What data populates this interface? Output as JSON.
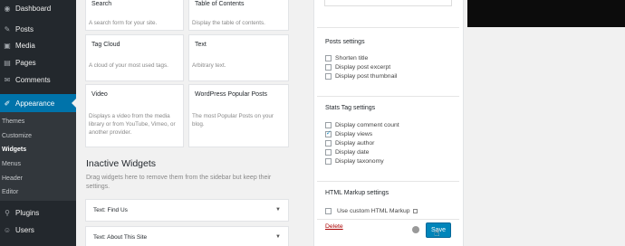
{
  "sidebar": {
    "items": [
      {
        "label": "Dashboard",
        "icon": "dashboard-icon",
        "glyph": "◉"
      },
      {
        "label": "Posts",
        "icon": "pin-icon",
        "glyph": "✎"
      },
      {
        "label": "Media",
        "icon": "media-icon",
        "glyph": "▣"
      },
      {
        "label": "Pages",
        "icon": "pages-icon",
        "glyph": "▤"
      },
      {
        "label": "Comments",
        "icon": "comments-icon",
        "glyph": "✉"
      },
      {
        "label": "Appearance",
        "icon": "brush-icon",
        "glyph": "✐"
      },
      {
        "label": "Plugins",
        "icon": "plugin-icon",
        "glyph": "⚲"
      },
      {
        "label": "Users",
        "icon": "users-icon",
        "glyph": "☺"
      }
    ],
    "submenu": [
      "Themes",
      "Customize",
      "Widgets",
      "Menus",
      "Header",
      "Editor"
    ],
    "accent": "#0073aa"
  },
  "widgets": {
    "search": {
      "title": "Search",
      "desc": "A search form for your site."
    },
    "toc": {
      "title": "Table of Contents",
      "desc": "Display the table of contents."
    },
    "tag_cloud": {
      "title": "Tag Cloud",
      "desc": "A cloud of your most used tags."
    },
    "text": {
      "title": "Text",
      "desc": "Arbitrary text."
    },
    "video": {
      "title": "Video",
      "desc": "Displays a video from the media library or from YouTube, Vimeo, or another provider."
    },
    "popular": {
      "title": "WordPress Popular Posts",
      "desc": "The most Popular Posts on your blog."
    }
  },
  "inactive": {
    "title": "Inactive Widgets",
    "desc": "Drag widgets here to remove them from the sidebar but keep their settings.",
    "rows": [
      "Text: Find Us",
      "Text: About This Site"
    ]
  },
  "panel": {
    "posts_settings": {
      "title": "Posts settings",
      "options": [
        {
          "label": "Shorten title",
          "checked": false
        },
        {
          "label": "Display post excerpt",
          "checked": false
        },
        {
          "label": "Display post thumbnail",
          "checked": false
        }
      ]
    },
    "stats_tag": {
      "title": "Stats Tag settings",
      "options": [
        {
          "label": "Display comment count",
          "checked": false
        },
        {
          "label": "Display views",
          "checked": true
        },
        {
          "label": "Display author",
          "checked": false
        },
        {
          "label": "Display date",
          "checked": false
        },
        {
          "label": "Display taxonomy",
          "checked": false
        }
      ]
    },
    "html_markup": {
      "title": "HTML Markup settings",
      "option": {
        "label": "Use custom HTML Markup",
        "checked": false
      }
    },
    "delete_label": "Delete",
    "save_label": "Save"
  }
}
